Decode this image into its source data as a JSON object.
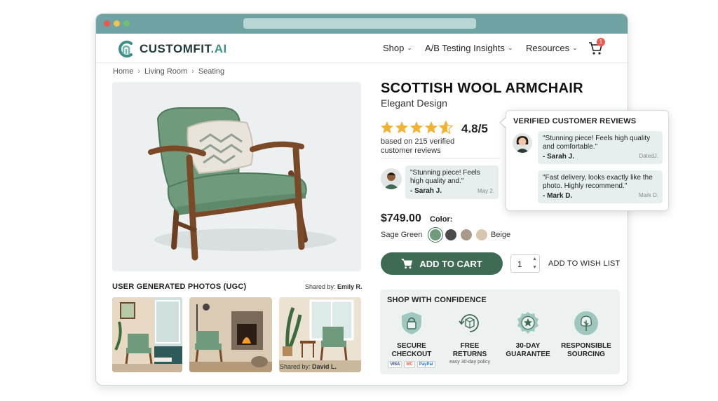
{
  "brand": {
    "name_main": "CUSTOMFIT",
    "name_suffix": ".AI"
  },
  "nav": {
    "items": [
      {
        "label": "Shop"
      },
      {
        "label": "A/B Testing Insights"
      },
      {
        "label": "Resources"
      }
    ],
    "cart_count": "1"
  },
  "breadcrumb": [
    "Home",
    "Living Room",
    "Seating"
  ],
  "product": {
    "title": "SCOTTISH WOOL ARMCHAIR",
    "subtitle": "Elegant Design",
    "rating": "4.8/5",
    "rating_value": 4.8,
    "rating_max": 5,
    "rating_note": "based on 215 verified customer reviews",
    "price": "$749.00",
    "color_label": "Color:",
    "selected_color": "Sage Green",
    "colors": [
      {
        "name": "Sage Green",
        "hex": "#6f9a7c",
        "selected": true
      },
      {
        "name": "Charcoal",
        "hex": "#4b4b4b",
        "selected": false
      },
      {
        "name": "Taupe",
        "hex": "#a89a8a",
        "selected": false
      },
      {
        "name": "Beige",
        "hex": "#d7c7ae",
        "selected": false
      }
    ],
    "beige_label": "Beige"
  },
  "inline_review": {
    "text": "\"Stunning piece! Feels high quality and.\"",
    "author": "- Sarah J.",
    "date": "May 2."
  },
  "actions": {
    "add_to_cart": "ADD TO CART",
    "quantity": "1",
    "wish_list": "ADD TO WISH LIST"
  },
  "ugc": {
    "title": "USER GENERATED PHOTOS (UGC)",
    "shared_prefix": "Shared by:",
    "shared_by_1": "Emily R.",
    "shared_by_2": "David L."
  },
  "confidence": {
    "title": "SHOP WITH CONFIDENCE",
    "items": [
      {
        "line1": "SECURE",
        "line2": "CHECKOUT",
        "icon": "lock-shield-icon"
      },
      {
        "line1": "FREE",
        "line2": "RETURNS",
        "note": "easy 30-day policy",
        "icon": "return-box-icon"
      },
      {
        "line1": "30-DAY",
        "line2": "GUARANTEE",
        "icon": "star-badge-icon"
      },
      {
        "line1": "RESPONSIBLE",
        "line2": "SOURCING",
        "icon": "tree-icon"
      }
    ],
    "payments": [
      "VISA",
      "MC",
      "PayPal"
    ]
  },
  "popover": {
    "title": "VERIFIED CUSTOMER REVIEWS",
    "reviews": [
      {
        "text": "\"Stunning piece! Feels high quality and comfortable.\"",
        "author": "- Sarah J.",
        "date": "DatedJ."
      },
      {
        "text": "\"Fast delivery, looks exactly like the photo. Highly recommend.\"",
        "author": "- Mark D.",
        "date": "Mark D."
      }
    ]
  },
  "colors": {
    "accent": "#3f6b55",
    "teal": "#6fa3a3",
    "brand": "#3f8f86"
  }
}
